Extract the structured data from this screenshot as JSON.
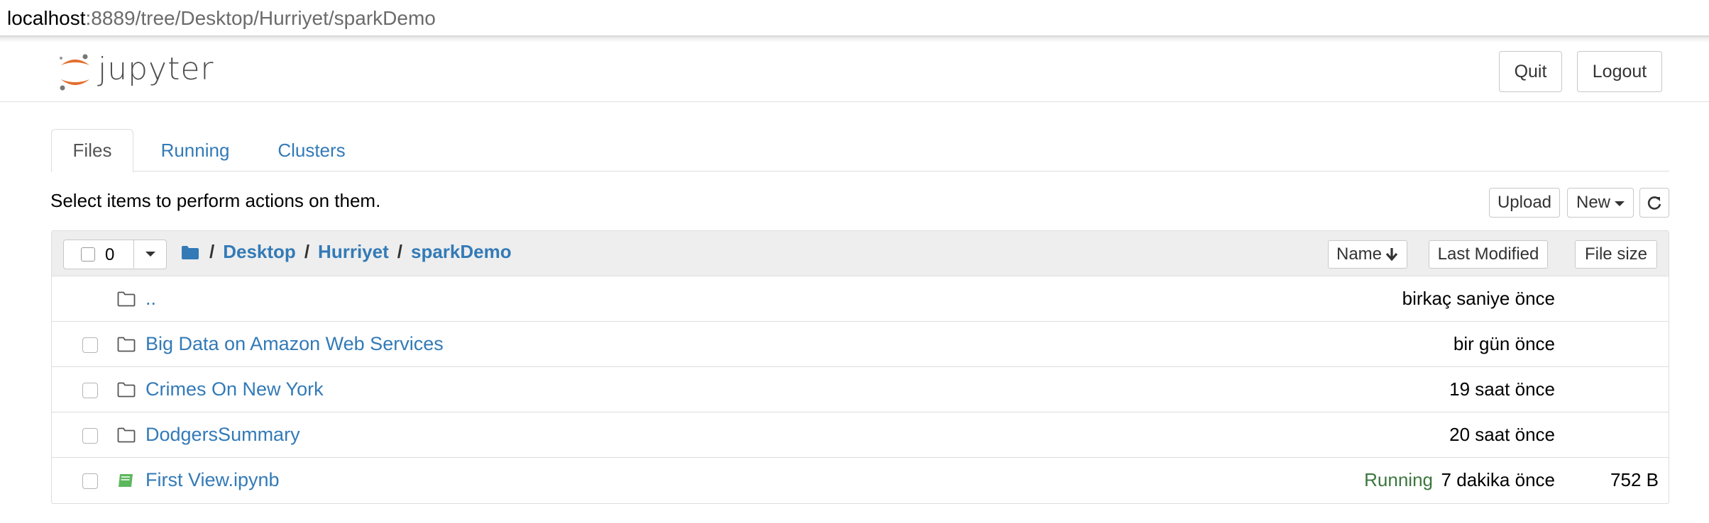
{
  "browser": {
    "url_host": "localhost",
    "url_path": ":8889/tree/Desktop/Hurriyet/sparkDemo"
  },
  "header": {
    "logo_text": "jupyter",
    "quit_label": "Quit",
    "logout_label": "Logout"
  },
  "tabs": [
    {
      "label": "Files",
      "active": true
    },
    {
      "label": "Running",
      "active": false
    },
    {
      "label": "Clusters",
      "active": false
    }
  ],
  "toolbar": {
    "select_message": "Select items to perform actions on them.",
    "upload_label": "Upload",
    "new_label": "New"
  },
  "list_header": {
    "selected_count": "0",
    "breadcrumb": [
      "Desktop",
      "Hurriyet",
      "sparkDemo"
    ],
    "sort_name_label": "Name",
    "sort_modified_label": "Last Modified",
    "sort_size_label": "File size"
  },
  "rows": [
    {
      "name": "..",
      "type": "folder",
      "modified": "birkaç saniye önce",
      "status": "",
      "size": "",
      "has_checkbox": false
    },
    {
      "name": "Big Data on Amazon Web Services",
      "type": "folder",
      "modified": "bir gün önce",
      "status": "",
      "size": "",
      "has_checkbox": true
    },
    {
      "name": "Crimes On New York",
      "type": "folder",
      "modified": "19 saat önce",
      "status": "",
      "size": "",
      "has_checkbox": true
    },
    {
      "name": "DodgersSummary",
      "type": "folder",
      "modified": "20 saat önce",
      "status": "",
      "size": "",
      "has_checkbox": true
    },
    {
      "name": "First View.ipynb",
      "type": "notebook",
      "modified": "7 dakika önce",
      "status": "Running",
      "size": "752 B",
      "has_checkbox": true
    }
  ],
  "colors": {
    "link": "#337ab7",
    "running": "#3c763d",
    "notebook_icon": "#5cb85c",
    "logo_orange": "#e46e2e"
  }
}
